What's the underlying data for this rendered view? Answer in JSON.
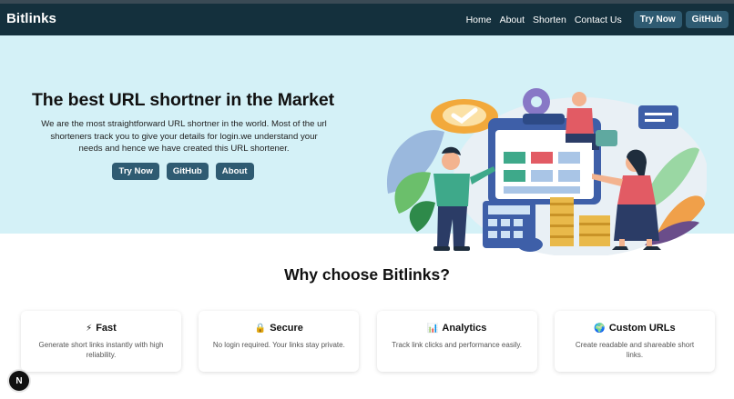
{
  "nav": {
    "brand": "Bitlinks",
    "links": [
      "Home",
      "About",
      "Shorten",
      "Contact Us"
    ],
    "buttons": [
      "Try Now",
      "GitHub"
    ]
  },
  "hero": {
    "title": "The best URL shortner in the Market",
    "subtitle": "We are the most straightforward URL shortner in the world. Most of the url shorteners track you to give your details for login.we understand your needs and hence we have created this URL shortener.",
    "buttons": [
      "Try Now",
      "GitHub",
      "About"
    ],
    "illustration": "people-working-with-dashboard-illustration"
  },
  "why": {
    "title": "Why choose Bitlinks?",
    "cards": [
      {
        "icon": "⚡",
        "icon_name": "lightning-icon",
        "title": "Fast",
        "desc": "Generate short links instantly with high reliability."
      },
      {
        "icon": "🔒",
        "icon_name": "lock-icon",
        "title": "Secure",
        "desc": "No login required. Your links stay private."
      },
      {
        "icon": "📊",
        "icon_name": "chart-icon",
        "title": "Analytics",
        "desc": "Track link clicks and performance easily."
      },
      {
        "icon": "🌍",
        "icon_name": "globe-icon",
        "title": "Custom URLs",
        "desc": "Create readable and shareable short links."
      }
    ]
  },
  "badge": {
    "label": "N"
  },
  "colors": {
    "navbar": "#14303d",
    "button": "#2f5b72",
    "hero_bg": "#d4f1f7"
  }
}
